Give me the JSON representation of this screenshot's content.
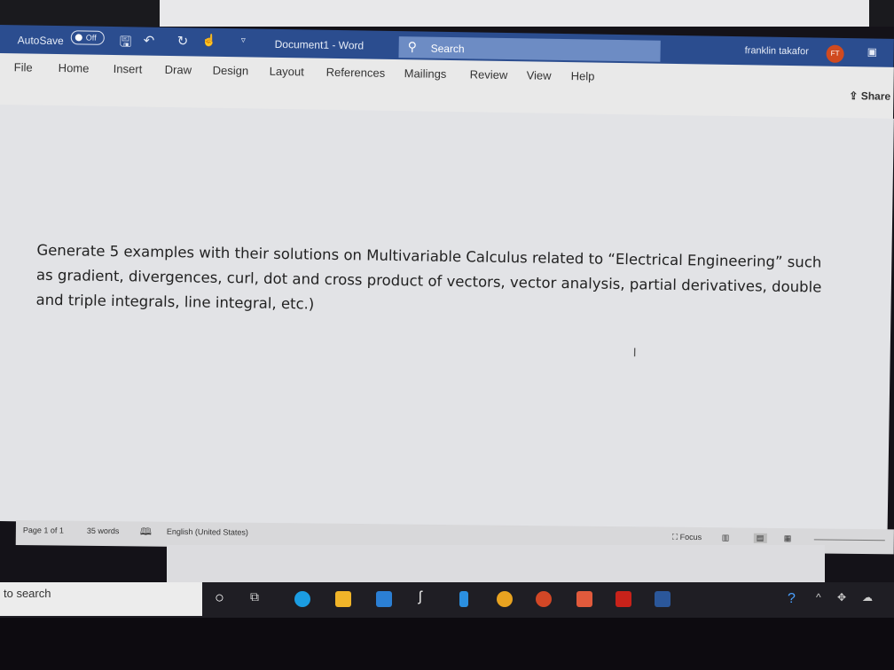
{
  "titlebar": {
    "autosave_label": "AutoSave",
    "autosave_state": "Off",
    "doc_title": "Document1  -  Word",
    "search_label": "Search",
    "user_name": "franklin takafor",
    "user_initials": "FT"
  },
  "ribbon": {
    "tabs": [
      "File",
      "Home",
      "Insert",
      "Draw",
      "Design",
      "Layout",
      "References",
      "Mailings",
      "Review",
      "View",
      "Help"
    ],
    "share_label": "Share"
  },
  "document": {
    "text": "Generate 5 examples with their solutions on Multivariable Calculus related to “Electrical Engineering” such as gradient, divergences, curl, dot and cross product of vectors, vector analysis, partial derivatives, double and triple integrals, line integral, etc.)"
  },
  "status": {
    "page": "Page 1 of 1",
    "words": "35 words",
    "language": "English (United States)",
    "focus": "Focus"
  },
  "taskbar": {
    "search_placeholder": "to search",
    "apps": [
      "cortana",
      "task-view",
      "edge",
      "file-explorer",
      "mail",
      "app-s",
      "app-blue",
      "chrome",
      "powerpoint",
      "media",
      "acrobat",
      "word"
    ],
    "colors": {
      "edge": "#1b9de2",
      "file-explorer": "#f0b429",
      "mail": "#2b7fd4",
      "chrome": "#e8a320",
      "powerpoint": "#d24726",
      "media": "#e15a3c",
      "acrobat": "#c8221a",
      "word": "#2b579a"
    }
  }
}
